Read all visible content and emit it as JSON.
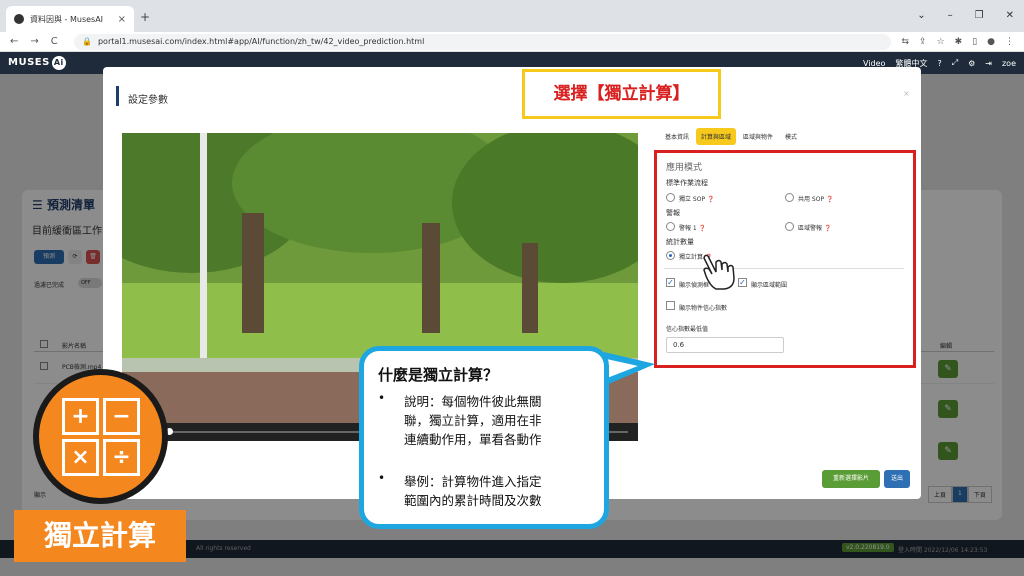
{
  "browser": {
    "tab_title": "資料因與 - MusesAI",
    "url": "portal1.musesai.com/index.html#app/AI/function/zh_tw/42_video_prediction.html",
    "tab_close": "×",
    "new_tab": "+",
    "nav_back": "←",
    "nav_forward": "→",
    "nav_reload": "C",
    "win_controls": [
      "⌄",
      "–",
      "❐",
      "✕"
    ]
  },
  "appbar": {
    "logo": "MUSES",
    "logo_ai": "Ai",
    "video_menu": "Video",
    "lang_menu": "繁體中文",
    "user": "zoe"
  },
  "panel": {
    "title": "預測清單",
    "subtitle": "目前緩衝區工作",
    "btn_predict": "預測",
    "note": "過濾已完成",
    "toggle": "OFF",
    "col_name": "影片名稱",
    "col_edit": "編輯",
    "row1_name": "PCB檢測.mp4",
    "footer_left": "顯示",
    "copyright": "All rights reserved",
    "version": "v2.0.220819.0",
    "login_info": "登入時間 2022/12/06 14:23:53",
    "pager": [
      "上頁",
      "1",
      "下頁"
    ]
  },
  "modal": {
    "title": "設定參數",
    "close": "×",
    "tabs": [
      "基本資訊",
      "計算與區域",
      "區域與物件",
      "模式"
    ],
    "section_head": "應用模式",
    "group_sop": "標準作業流程",
    "opt_sop_independent": "獨立 SOP",
    "opt_sop_shared": "共用 SOP",
    "group_alarm": "警報",
    "opt_alarm_1": "警報 1",
    "opt_alarm_region": "區域警報",
    "group_count": "統計數量",
    "opt_independent_calc": "獨立計算",
    "chk_show_detect": "顯示偵測框",
    "chk_show_region": "顯示區域範圍",
    "chk_show_confidence": "顯示物件信心指數",
    "threshold_label": "信心指數最低值",
    "threshold_value": "0.6",
    "btn_reset": "重新選擇影片",
    "btn_submit": "送出"
  },
  "callout_select": "選擇【獨立計算】",
  "bubble": {
    "title": "什麼是獨立計算？",
    "bullet": "•",
    "l1": "說明：每個物件彼此無關",
    "l2": "聯，獨立計算，適用在非",
    "l3": "連續動作用，單看各動作",
    "l4": "舉例：計算物件進入指定",
    "l5": "範圍內的累計時間及次數"
  },
  "badge": {
    "label": "獨立計算",
    "symbols": [
      "+",
      "−",
      "×",
      "÷"
    ]
  },
  "colors": {
    "highlight_red": "#d92020",
    "accent_yellow": "#f6c91c",
    "bubble_blue": "#1ea6e0",
    "badge_orange": "#f5871f",
    "btn_green": "#5a9c35",
    "btn_blue": "#2f6fb3"
  }
}
